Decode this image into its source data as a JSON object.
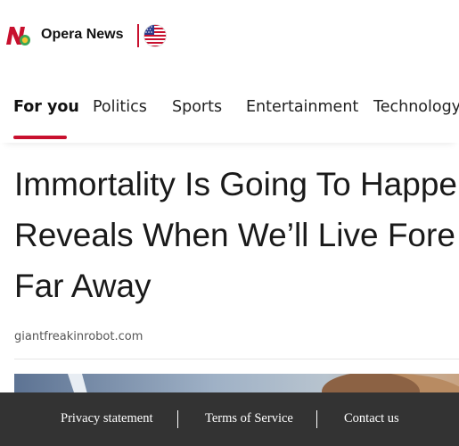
{
  "header": {
    "brand_name": "Opera News",
    "logo_icon": "opera-news-logo",
    "flag_icon": "us-flag-icon",
    "colors": {
      "brand_red": "#c8102e",
      "logo_green": "#3aa655"
    }
  },
  "nav": {
    "tabs": [
      {
        "label": "For you",
        "active": true
      },
      {
        "label": "Politics",
        "active": false
      },
      {
        "label": "Sports",
        "active": false
      },
      {
        "label": "Entertainment",
        "active": false
      },
      {
        "label": "Technology",
        "active": false
      }
    ]
  },
  "article": {
    "headline_lines": [
      "Immortality Is Going To Happe",
      "Reveals When We’ll Live Fore",
      "Far Away"
    ],
    "source": "giantfreakinrobot.com"
  },
  "footer": {
    "links": [
      {
        "label": "Privacy statement"
      },
      {
        "label": "Terms of Service"
      },
      {
        "label": "Contact us"
      }
    ],
    "background": "#333333"
  }
}
